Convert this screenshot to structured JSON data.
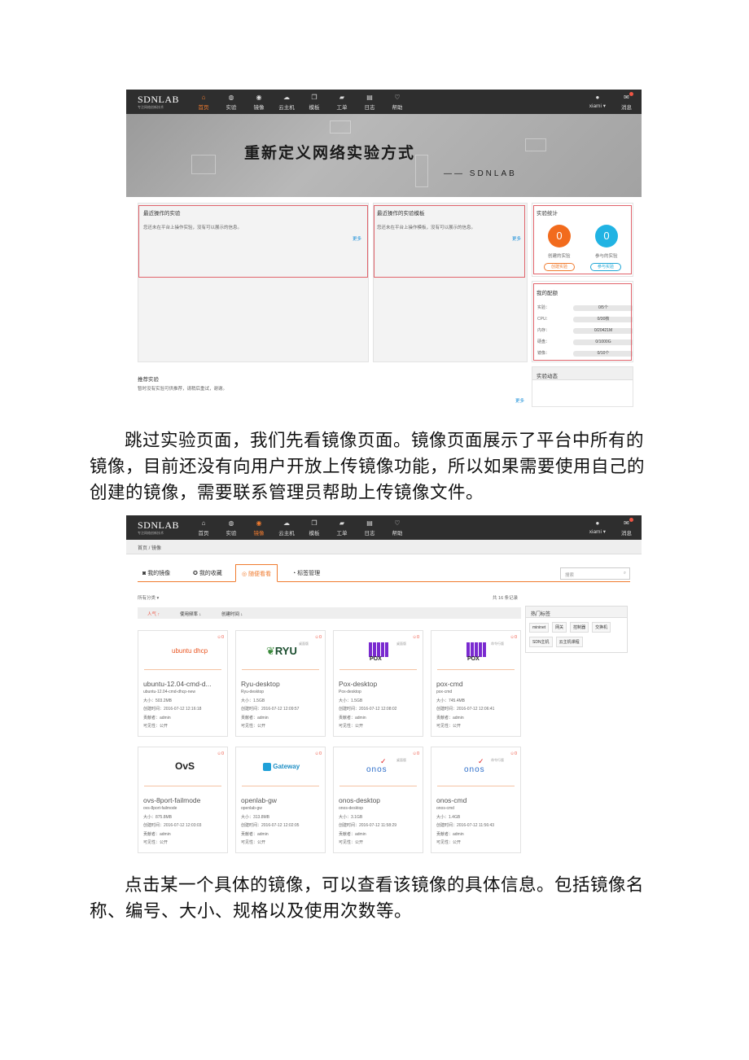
{
  "colors": {
    "accent": "#f07b2f",
    "blue": "#21a7d6",
    "highlight": "#e0636b",
    "topbar": "#2e2e2e"
  },
  "nav": {
    "logo": "SDNLAB",
    "logo_sub": "专注网络创新技术",
    "items": [
      {
        "label": "首页",
        "icon": "home-icon"
      },
      {
        "label": "实验",
        "icon": "globe-icon"
      },
      {
        "label": "镜像",
        "icon": "disc-icon"
      },
      {
        "label": "云主机",
        "icon": "cloud-icon"
      },
      {
        "label": "模板",
        "icon": "copy-icon"
      },
      {
        "label": "工单",
        "icon": "comment-icon"
      },
      {
        "label": "日志",
        "icon": "calendar-icon"
      },
      {
        "label": "帮助",
        "icon": "heart-icon"
      }
    ],
    "user": "xiami ▾",
    "message": "消息"
  },
  "screen1": {
    "banner_title": "重新定义网络实验方式",
    "banner_sub": "—— SDNLAB",
    "recent_exp": {
      "title": "最近操作的实验",
      "text": "您还未在平台上操作实验，没有可以展示的信息。",
      "more": "更多"
    },
    "recent_tpl": {
      "title": "最近操作的实验模板",
      "text": "您还未在平台上操作模板，没有可以展示的信息。",
      "more": "更多"
    },
    "stats": {
      "title": "实验统计",
      "created": "0",
      "created_label": "创建的实验",
      "joined": "0",
      "joined_label": "参与的实验",
      "create_btn": "创建实验",
      "join_btn": "参与实验"
    },
    "quota": {
      "title": "我的配额",
      "rows": [
        {
          "label": "实验：",
          "value": "0/5个"
        },
        {
          "label": "CPU：",
          "value": "0/30核"
        },
        {
          "label": "内存：",
          "value": "0/20421M"
        },
        {
          "label": "硬盘：",
          "value": "0/1000G"
        },
        {
          "label": "镜像：",
          "value": "0/10个"
        }
      ]
    },
    "recommend": {
      "title": "推荐实验",
      "text": "暂时没有实验可供推荐，请稍后重试，谢谢。",
      "more": "更多"
    },
    "activity": {
      "title": "实验动态"
    }
  },
  "para1": "跳过实验页面，我们先看镜像页面。镜像页面展示了平台中所有的镜像，目前还没有向用户开放上传镜像功能，所以如果需要使用自己的创建的镜像，需要联系管理员帮助上传镜像文件。",
  "screen2": {
    "breadcrumb": "首页 / 镜像",
    "tabs": [
      "我的镜像",
      "我的收藏",
      "随便看看",
      "标签管理"
    ],
    "search_placeholder": "搜索",
    "category": "所有分类 ▾",
    "total": "共 16 条记录",
    "sorts": [
      "人气 ↑",
      "使用频率 ↓",
      "创建时间 ↓"
    ],
    "hot_tags_title": "热门标签",
    "hot_tags": [
      "mininet",
      "网关",
      "控制器",
      "交换机",
      "SDN主机",
      "云主机课程"
    ],
    "cards": [
      {
        "logo": "ubuntu dhcp",
        "name": "ubuntu-12.04-cmd-d...",
        "id": "ubuntu-12.04-cmd-dhcp-new",
        "size": "大小：503.2MB",
        "created": "创建时间：2016-07-12 12:16:18",
        "author": "贡献者：admin",
        "visible": "可见性：公开",
        "comments": "0",
        "badge": ""
      },
      {
        "logo": "RYU",
        "name": "Ryu-desktop",
        "id": "Ryu-desktop",
        "size": "大小：1.5GB",
        "created": "创建时间：2016-07-12 12:09:57",
        "author": "贡献者：admin",
        "visible": "可见性：公开",
        "comments": "0",
        "badge": "桌面版"
      },
      {
        "logo": "POX",
        "name": "Pox-desktop",
        "id": "Pox-desktop",
        "size": "大小：1.5GB",
        "created": "创建时间：2016-07-12 12:08:02",
        "author": "贡献者：admin",
        "visible": "可见性：公开",
        "comments": "0",
        "badge": "桌面版"
      },
      {
        "logo": "POX",
        "name": "pox-cmd",
        "id": "pox-cmd",
        "size": "大小：745.4MB",
        "created": "创建时间：2016-07-12 12:06:41",
        "author": "贡献者：admin",
        "visible": "可见性：公开",
        "comments": "0",
        "badge": "命令行版"
      },
      {
        "logo": "OvS",
        "name": "ovs-8port-failmode",
        "id": "ovs-8port-failmode",
        "size": "大小：875.8MB",
        "created": "创建时间：2016-07-12 12:03:03",
        "author": "贡献者：admin",
        "visible": "可见性：公开",
        "comments": "0",
        "badge": ""
      },
      {
        "logo": "Gateway",
        "name": "openlab-gw",
        "id": "openlab-gw",
        "size": "大小：313.8MB",
        "created": "创建时间：2016-07-12 12:02:05",
        "author": "贡献者：admin",
        "visible": "可见性：公开",
        "comments": "0",
        "badge": ""
      },
      {
        "logo": "onos",
        "name": "onos-desktop",
        "id": "onos-desktop",
        "size": "大小：3.1GB",
        "created": "创建时间：2016-07-12 11:58:29",
        "author": "贡献者：admin",
        "visible": "可见性：公开",
        "comments": "0",
        "badge": "桌面版"
      },
      {
        "logo": "onos",
        "name": "onos-cmd",
        "id": "onos-cmd",
        "size": "大小：1.4GB",
        "created": "创建时间：2016-07-12 11:56:43",
        "author": "贡献者：admin",
        "visible": "可见性：公开",
        "comments": "0",
        "badge": "命令行版"
      }
    ]
  },
  "para2": "点击某一个具体的镜像，可以查看该镜像的具体信息。包括镜像名称、编号、大小、规格以及使用次数等。"
}
